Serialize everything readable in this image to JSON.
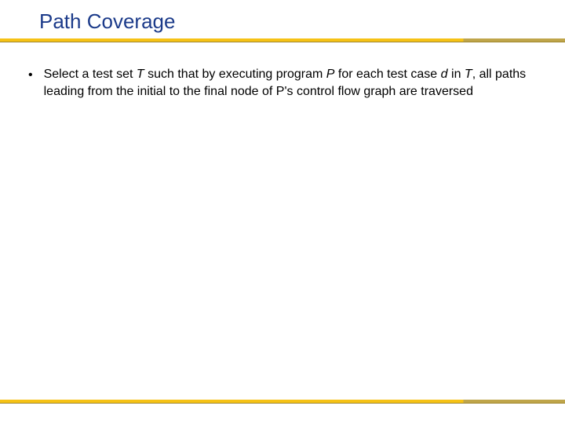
{
  "slide": {
    "title": "Path Coverage",
    "bullets": [
      {
        "pre": "Select a test set ",
        "var1": "T",
        "mid1": " such that by executing program ",
        "var2": "P",
        "mid2": " for each test case ",
        "var3": "d",
        "mid3": " in ",
        "var4": "T",
        "post": ", all paths leading from the initial to the final node of P's control flow graph are traversed"
      }
    ],
    "bullet_marker": "•"
  }
}
